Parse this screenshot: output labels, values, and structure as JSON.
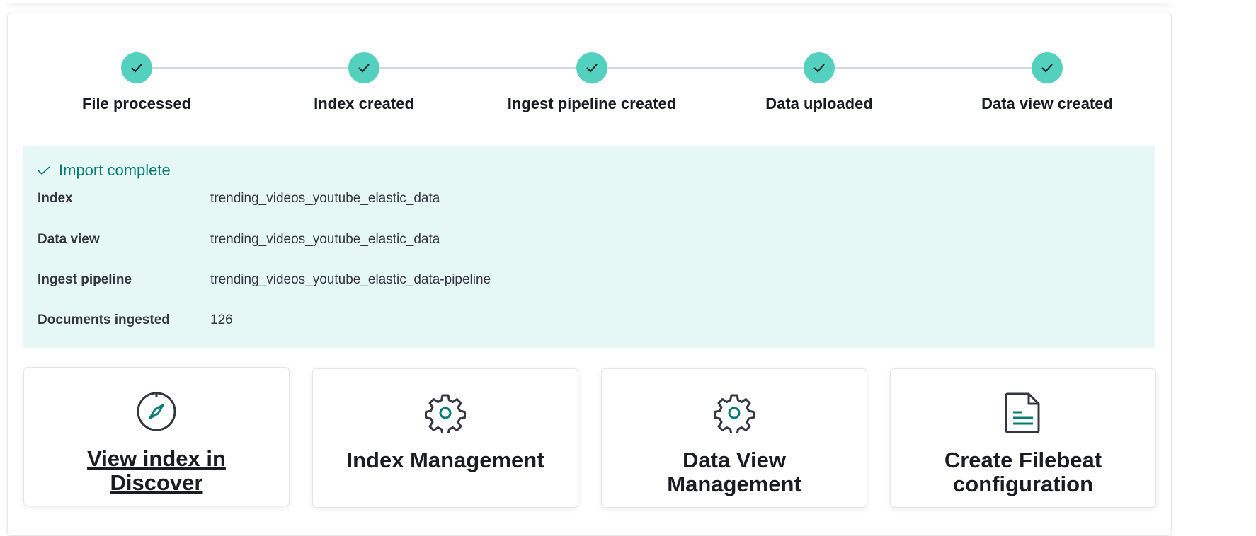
{
  "steps": [
    {
      "label": "File processed"
    },
    {
      "label": "Index created"
    },
    {
      "label": "Ingest pipeline created"
    },
    {
      "label": "Data uploaded"
    },
    {
      "label": "Data view created"
    }
  ],
  "callout": {
    "title": "Import complete",
    "rows": [
      {
        "key": "Index",
        "value": "trending_videos_youtube_elastic_data"
      },
      {
        "key": "Data view",
        "value": "trending_videos_youtube_elastic_data"
      },
      {
        "key": "Ingest pipeline",
        "value": "trending_videos_youtube_elastic_data-pipeline"
      },
      {
        "key": "Documents ingested",
        "value": "126"
      }
    ]
  },
  "cards": [
    {
      "title": "View index in Discover",
      "icon": "compass-icon"
    },
    {
      "title": "Index Management",
      "icon": "gear-icon"
    },
    {
      "title": "Data View Management",
      "icon": "gear-icon"
    },
    {
      "title": "Create Filebeat configuration",
      "icon": "document-icon"
    }
  ],
  "colors": {
    "step_complete": "#54d0be",
    "callout_bg": "#e6f8f5",
    "callout_title": "#017d73",
    "icon_accent": "#017d73"
  }
}
